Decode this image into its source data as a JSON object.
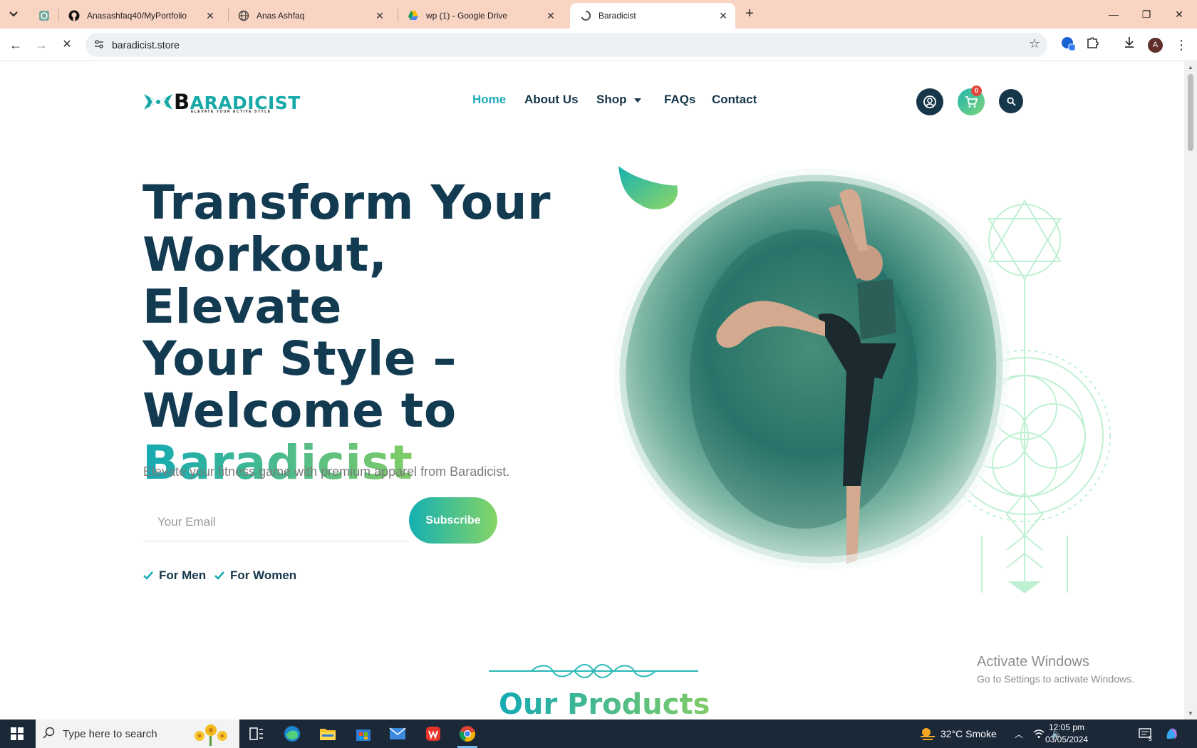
{
  "browser": {
    "tabs": [
      {
        "title": "",
        "icon": "chatgpt-icon",
        "active": false
      },
      {
        "title": "Anasashfaq40/MyPortfolio",
        "icon": "github-icon",
        "active": false
      },
      {
        "title": "Anas Ashfaq",
        "icon": "globe-icon",
        "active": false
      },
      {
        "title": "wp (1) - Google Drive",
        "icon": "google-drive-icon",
        "active": false
      },
      {
        "title": "Baradicist",
        "icon": "loading-icon",
        "active": true
      }
    ],
    "url": "baradicist.store",
    "profile_initial": "A"
  },
  "site": {
    "logo": {
      "initial": "B",
      "rest": "ARADICIST",
      "tagline": "ELEVATE YOUR ACTIVE STYLE"
    },
    "nav": [
      {
        "label": "Home",
        "active": true
      },
      {
        "label": "About Us",
        "active": false
      },
      {
        "label": "Shop",
        "active": false,
        "dropdown": true
      },
      {
        "label": "FAQs",
        "active": false
      },
      {
        "label": "Contact",
        "active": false
      }
    ],
    "cart_count": "0",
    "hero": {
      "title_lines": [
        "Transform Your",
        "Workout, Elevate",
        "Your Style –",
        "Welcome to"
      ],
      "title_brand": "Baradicist",
      "subtitle": "Elevate your fitness game with premium apparel from Baradicist.",
      "email_placeholder": "Your Email",
      "subscribe_label": "Subscribe",
      "checks": [
        "For Men",
        "For Women"
      ]
    },
    "section_title": "Our Products",
    "watermark": {
      "heading": "Activate Windows",
      "sub": "Go to Settings to activate Windows."
    }
  },
  "taskbar": {
    "search_placeholder": "Type here to search",
    "weather": "32°C  Smoke",
    "time": "12:05 pm",
    "date": "03/05/2024",
    "notification_count": "5"
  },
  "colors": {
    "brand_dark": "#16364a",
    "brand_teal": "#14a9b3",
    "brand_green": "#80cc66",
    "tab_strip": "#f9d4c3"
  }
}
